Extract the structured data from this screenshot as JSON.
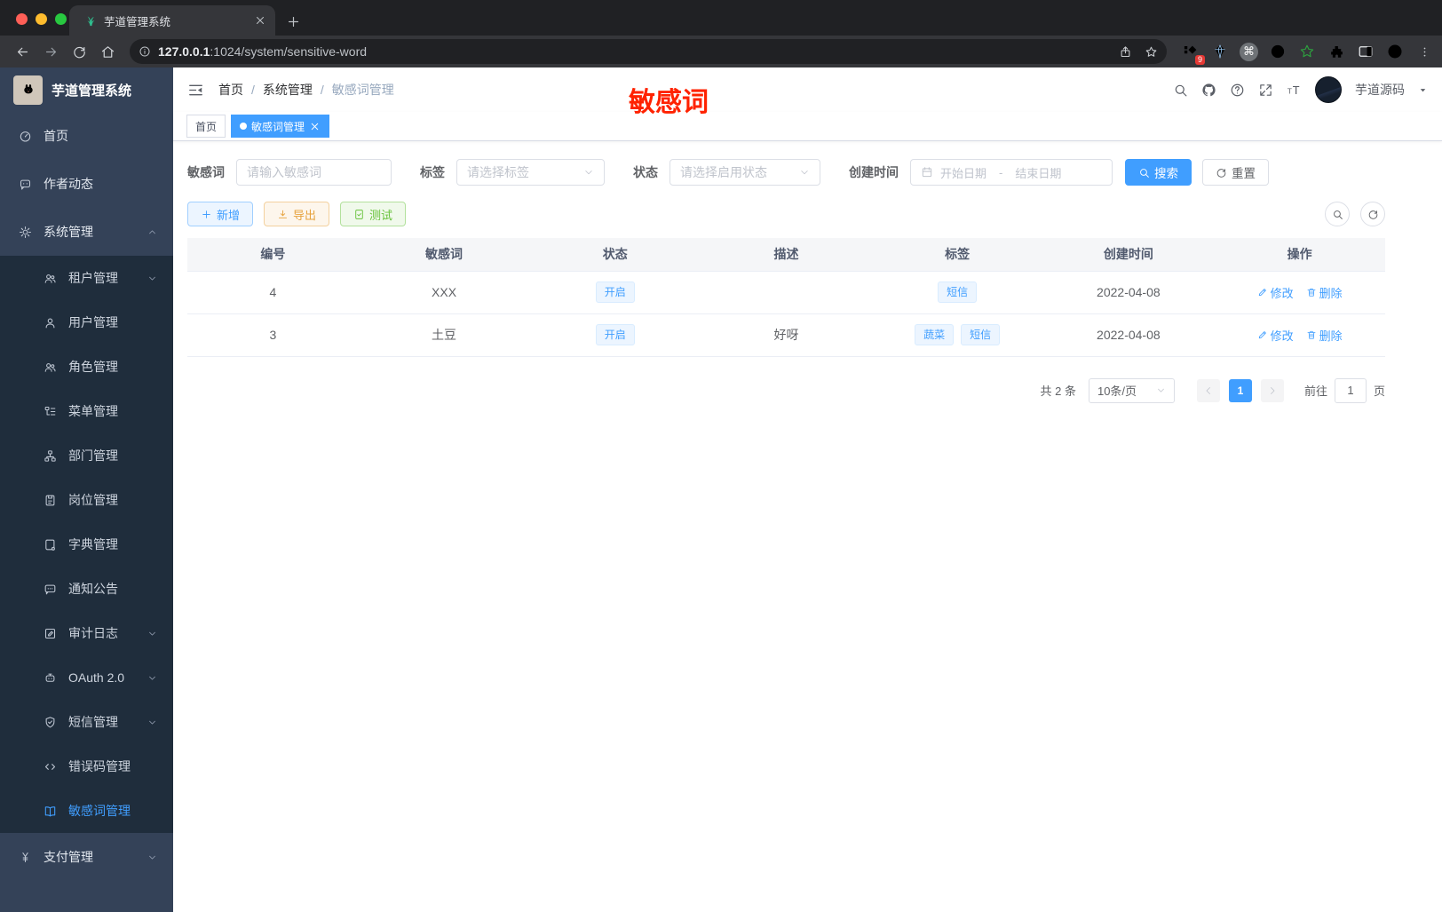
{
  "browser": {
    "tab_title": "芋道管理系统",
    "url_host": "127.0.0.1",
    "url_path": ":1024/system/sensitive-word",
    "extension_badge": "9"
  },
  "sidebar": {
    "app_title": "芋道管理系统",
    "items": [
      {
        "label": "首页",
        "icon": "dashboard-icon",
        "level": 1
      },
      {
        "label": "作者动态",
        "icon": "chat-icon",
        "level": 1
      },
      {
        "label": "系统管理",
        "icon": "gear-icon",
        "level": 1,
        "chevron": "up"
      },
      {
        "label": "租户管理",
        "icon": "users-icon",
        "level": 2,
        "chevron": "down"
      },
      {
        "label": "用户管理",
        "icon": "user-icon",
        "level": 2
      },
      {
        "label": "角色管理",
        "icon": "roles-icon",
        "level": 2
      },
      {
        "label": "菜单管理",
        "icon": "menu-tree-icon",
        "level": 2
      },
      {
        "label": "部门管理",
        "icon": "org-icon",
        "level": 2
      },
      {
        "label": "岗位管理",
        "icon": "post-icon",
        "level": 2
      },
      {
        "label": "字典管理",
        "icon": "dict-icon",
        "level": 2
      },
      {
        "label": "通知公告",
        "icon": "notice-icon",
        "level": 2
      },
      {
        "label": "审计日志",
        "icon": "log-icon",
        "level": 2,
        "chevron": "down"
      },
      {
        "label": "OAuth 2.0",
        "icon": "oauth-icon",
        "level": 2,
        "chevron": "down"
      },
      {
        "label": "短信管理",
        "icon": "sms-icon",
        "level": 2,
        "chevron": "down"
      },
      {
        "label": "错误码管理",
        "icon": "code-icon",
        "level": 2
      },
      {
        "label": "敏感词管理",
        "icon": "open-book-icon",
        "level": 2,
        "active": true
      },
      {
        "label": "支付管理",
        "icon": "pay-icon",
        "level": 1,
        "chevron": "down"
      }
    ]
  },
  "header": {
    "breadcrumb": [
      "首页",
      "系统管理",
      "敏感词管理"
    ],
    "username": "芋道源码",
    "annotation": "敏感词",
    "annotation_color": "#ff2200"
  },
  "tabs": [
    {
      "label": "首页",
      "active": false
    },
    {
      "label": "敏感词管理",
      "active": true
    }
  ],
  "filters": {
    "keyword_label": "敏感词",
    "keyword_placeholder": "请输入敏感词",
    "tag_label": "标签",
    "tag_placeholder": "请选择标签",
    "status_label": "状态",
    "status_placeholder": "请选择启用状态",
    "time_label": "创建时间",
    "start_placeholder": "开始日期",
    "separator": "-",
    "end_placeholder": "结束日期",
    "search_label": "搜索",
    "reset_label": "重置"
  },
  "toolbar": {
    "add_label": "新增",
    "export_label": "导出",
    "test_label": "测试"
  },
  "table": {
    "columns": [
      "编号",
      "敏感词",
      "状态",
      "描述",
      "标签",
      "创建时间",
      "操作"
    ],
    "rows": [
      {
        "id": "4",
        "word": "XXX",
        "status": "开启",
        "description": "",
        "tags": [
          "短信"
        ],
        "created": "2022-04-08"
      },
      {
        "id": "3",
        "word": "土豆",
        "status": "开启",
        "description": "好呀",
        "tags": [
          "蔬菜",
          "短信"
        ],
        "created": "2022-04-08"
      }
    ],
    "actions": {
      "edit": "修改",
      "delete": "删除"
    }
  },
  "pagination": {
    "total": "共 2 条",
    "page_size": "10条/页",
    "current_page": "1",
    "goto_label": "前往",
    "unit_label": "页",
    "goto_value": "1"
  },
  "colors": {
    "primary": "#409eff",
    "annotation_red": "#ff2200"
  }
}
